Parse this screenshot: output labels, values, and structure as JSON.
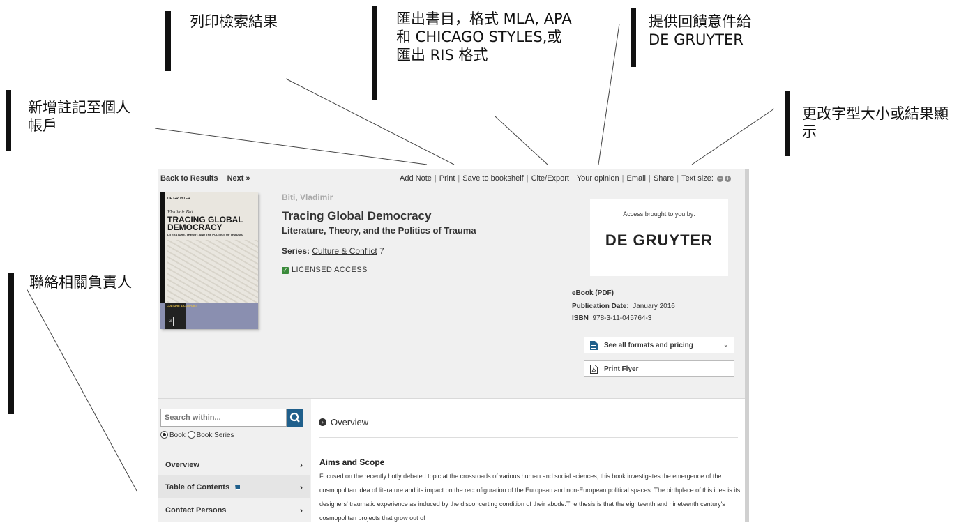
{
  "annotations": {
    "print": "列印檢索結果",
    "export": "匯出書目，格式 MLA, APA 和 CHICAGO STYLES,或匯出 RIS 格式",
    "feedback": "提供回饋意件給 DE GRUYTER",
    "add_note": "新增註記至個人帳戶",
    "text_size": "更改字型大小或結果顯示",
    "contact": "聯絡相關負責人"
  },
  "nav": {
    "back": "Back to Results",
    "next": "Next »"
  },
  "toolbar": {
    "add_note": "Add Note",
    "print": "Print",
    "save": "Save to bookshelf",
    "cite": "Cite/Export",
    "opinion": "Your opinion",
    "email": "Email",
    "share": "Share",
    "text_size": "Text size:"
  },
  "book": {
    "author": "Biti, Vladimir",
    "title": "Tracing Global Democracy",
    "subtitle": "Literature, Theory, and the Politics of Trauma",
    "series_label": "Series:",
    "series_name": "Culture & Conflict",
    "series_num": "7",
    "licensed": "LICENSED ACCESS"
  },
  "cover": {
    "publisher": "DE GRUYTER",
    "author": "Vladimir Biti",
    "title": "TRACING GLOBAL DEMOCRACY",
    "subtitle": "LITERATURE, THEORY, AND THE POLITICS OF TRAUMA",
    "series": "CULTURE & CONFLICT",
    "logo": "G"
  },
  "access": {
    "label": "Access brought to you by:",
    "brand": "DE GRUYTER"
  },
  "meta": {
    "format": "eBook (PDF)",
    "pub_label": "Publication Date:",
    "pub_value": "January 2016",
    "isbn_label": "ISBN",
    "isbn_value": "978-3-11-045764-3"
  },
  "buttons": {
    "pricing": "See all formats and pricing",
    "flyer": "Print Flyer"
  },
  "search": {
    "placeholder": "Search within...",
    "radio_book": "Book",
    "radio_series": "Book Series"
  },
  "sidenav": [
    "Overview",
    "Table of Contents",
    "Contact Persons"
  ],
  "overview": {
    "heading": "Overview",
    "aims": "Aims and Scope",
    "text": "Focused on the recently hotly debated topic at the crossroads of various human and social sciences, this book investigates the emergence of the cosmopolitan idea of literature and its impact on the reconfiguration of the European and non-European political spaces. The birthplace of this idea is its designers' traumatic experience as induced by the disconcerting condition of their abode.The thesis is that the eighteenth and nineteenth century's cosmopolitan projects that grow out of"
  },
  "colors": {
    "accent": "#1f5f8b",
    "check": "#3a8a3a"
  }
}
